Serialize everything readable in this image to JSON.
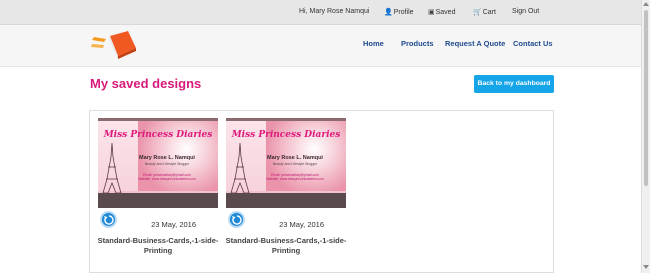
{
  "header": {
    "greeting": "Hi, Mary Rose Namqui",
    "profile": "Profile",
    "saved": "Saved",
    "cart": "Cart",
    "signout": "Sign Out"
  },
  "nav": {
    "home": "Home",
    "products": "Products",
    "request_quote": "Request A Quote",
    "contact": "Contact Us"
  },
  "main": {
    "title": "My saved designs",
    "dashboard_button": "Back to my dashboard"
  },
  "designs": [
    {
      "date": "23 May, 2016",
      "title": "Standard-Business-Cards,-1-side-Printing",
      "card_brand": "Miss Princess Diaries",
      "card_name": "Mary Rose L. Namqui",
      "card_role": "Beauty and Lifestyle Blogger",
      "card_email": "Email: princessdiary@ymail.com",
      "card_web": "Website: www.missprincessdiaries.com"
    },
    {
      "date": "23 May, 2016",
      "title": "Standard-Business-Cards,-1-side-Printing",
      "card_brand": "Miss Princess Diaries",
      "card_name": "Mary Rose L. Namqui",
      "card_role": "Beauty and Lifestyle Blogger",
      "card_email": "Email: princessdiary@ymail.com",
      "card_web": "Website: www.missprincessdiaries.com"
    }
  ],
  "colors": {
    "title_pink": "#d81b7a",
    "nav_blue": "#1f4b8f",
    "button_blue": "#14a4e8",
    "logo_orange": "#f05a22"
  }
}
